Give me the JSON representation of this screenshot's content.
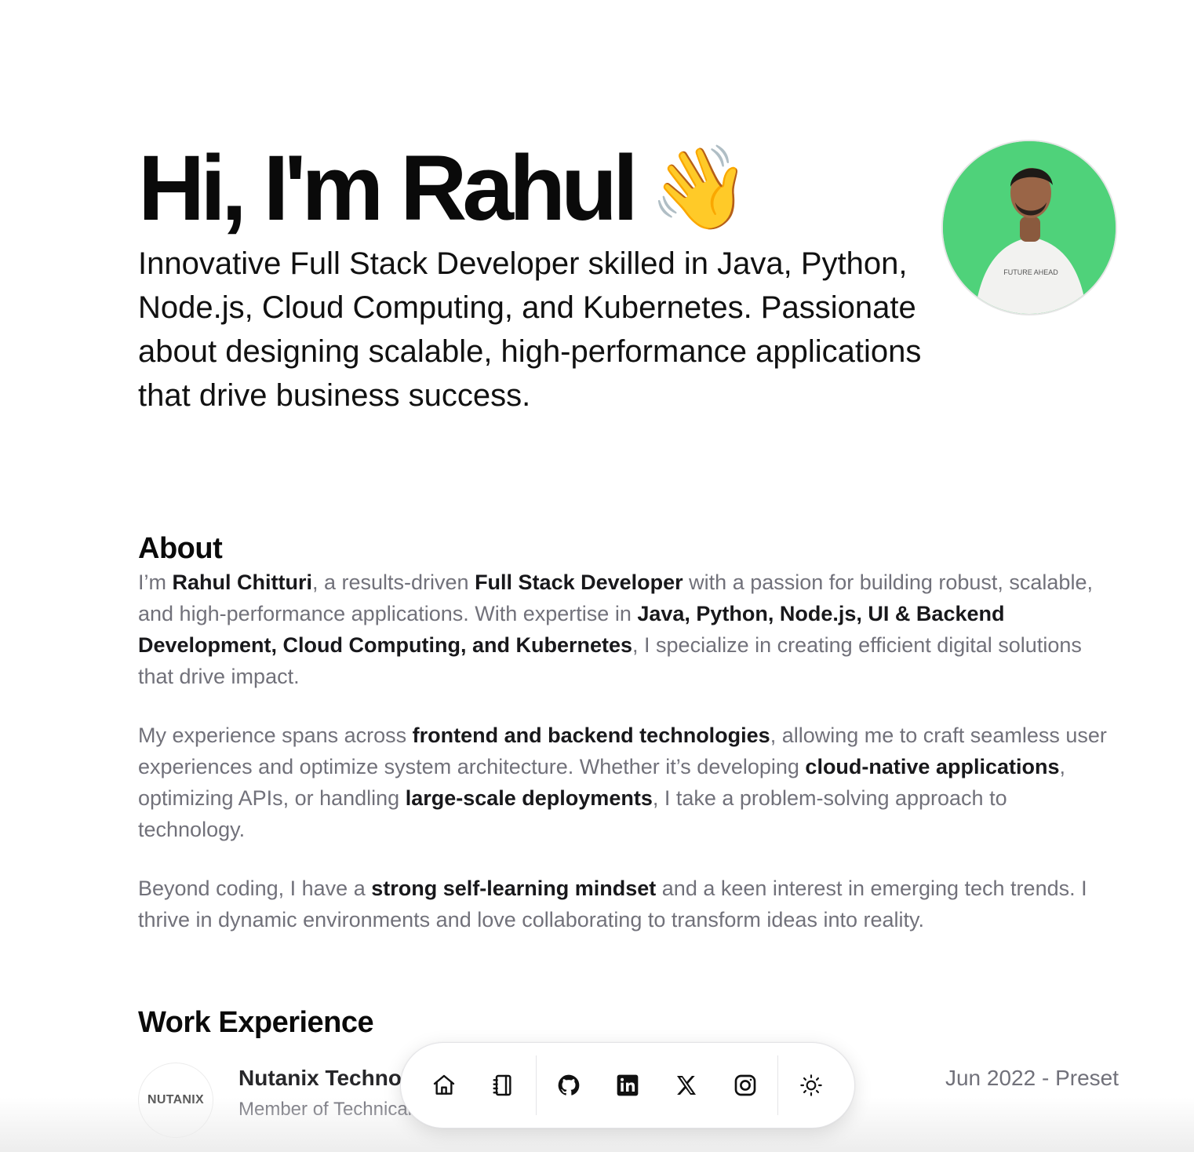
{
  "hero": {
    "title": "Hi, I'm Rahul",
    "emoji": "👋",
    "subtitle": "Innovative Full Stack Developer skilled in Java, Python, Node.js, Cloud Computing, and Kubernetes. Passionate about designing scalable, high-performance applications that drive business success.",
    "avatar_shirt_text": "FUTURE AHEAD"
  },
  "about": {
    "heading": "About",
    "p1": {
      "t1": "I’m ",
      "b1": "Rahul Chitturi",
      "t2": ", a results-driven ",
      "b2": "Full Stack Developer",
      "t3": " with a passion for building robust, scalable, and high-performance applications. With expertise in ",
      "b3": "Java, Python, Node.js, UI & Backend Development, Cloud Computing, and Kubernetes",
      "t4": ", I specialize in creating efficient digital solutions that drive impact."
    },
    "p2": {
      "t1": "My experience spans across ",
      "b1": "frontend and backend technologies",
      "t2": ", allowing me to craft seamless user experiences and optimize system architecture. Whether it’s developing ",
      "b2": "cloud-native applications",
      "t3": ", optimizing APIs, or handling ",
      "b3": "large-scale deployments",
      "t4": ", I take a problem-solving approach to technology."
    },
    "p3": {
      "t1": "Beyond coding, I have a ",
      "b1": "strong self-learning mindset",
      "t2": " and a keen interest in emerging tech trends. I thrive in dynamic environments and love collaborating to transform ideas into reality."
    }
  },
  "work": {
    "heading": "Work Experience",
    "items": [
      {
        "logo_text": "NUTANIX",
        "company": "Nutanix Technologies",
        "role": "Member of Technical Staff",
        "date": "Jun 2022 - Preset"
      }
    ]
  },
  "dock": {
    "icons": [
      "home-icon",
      "notebook-icon",
      "github-icon",
      "linkedin-icon",
      "x-icon",
      "instagram-icon",
      "sun-icon"
    ]
  },
  "colors": {
    "heading": "#0a0a0a",
    "muted_text": "#71717a",
    "bold_text": "#18181b",
    "avatar_bg": "#4fd27a"
  }
}
